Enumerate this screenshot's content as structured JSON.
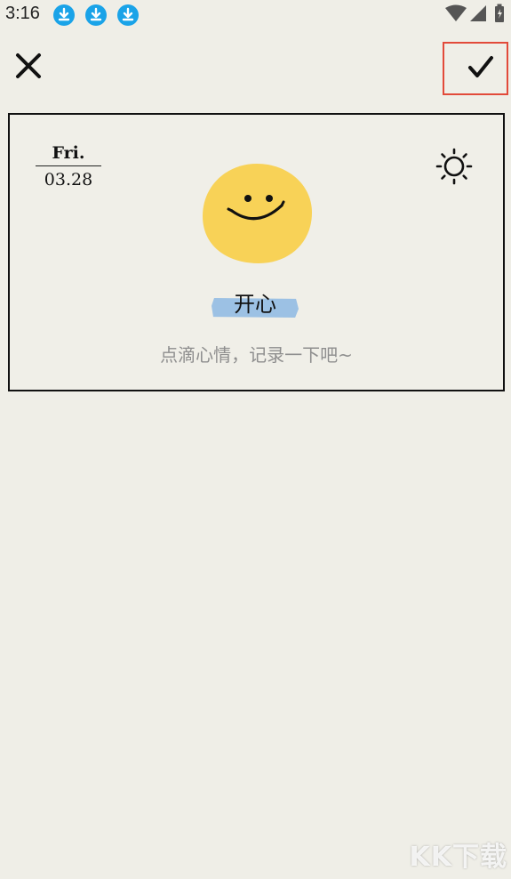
{
  "status_bar": {
    "time": "3:16",
    "notification_icons": [
      "download-icon",
      "download-icon",
      "download-icon"
    ],
    "indicators": [
      "wifi-icon",
      "signal-icon",
      "battery-charging-icon"
    ]
  },
  "header": {
    "close_icon": "close-icon",
    "confirm_icon": "checkmark-icon"
  },
  "entry": {
    "weekday": "Fri.",
    "date": "03.28",
    "weather_icon": "sun-icon",
    "mood_icon": "smiley-face-icon",
    "mood_label": "开心",
    "note_placeholder": "点滴心情，记录一下吧~"
  },
  "watermark": "KK下载",
  "colors": {
    "background": "#efeee7",
    "mood_face": "#f8d257",
    "mood_tape": "#9cc1e4",
    "highlight_border": "#e24a3a",
    "download_badge": "#1aa3e8"
  }
}
